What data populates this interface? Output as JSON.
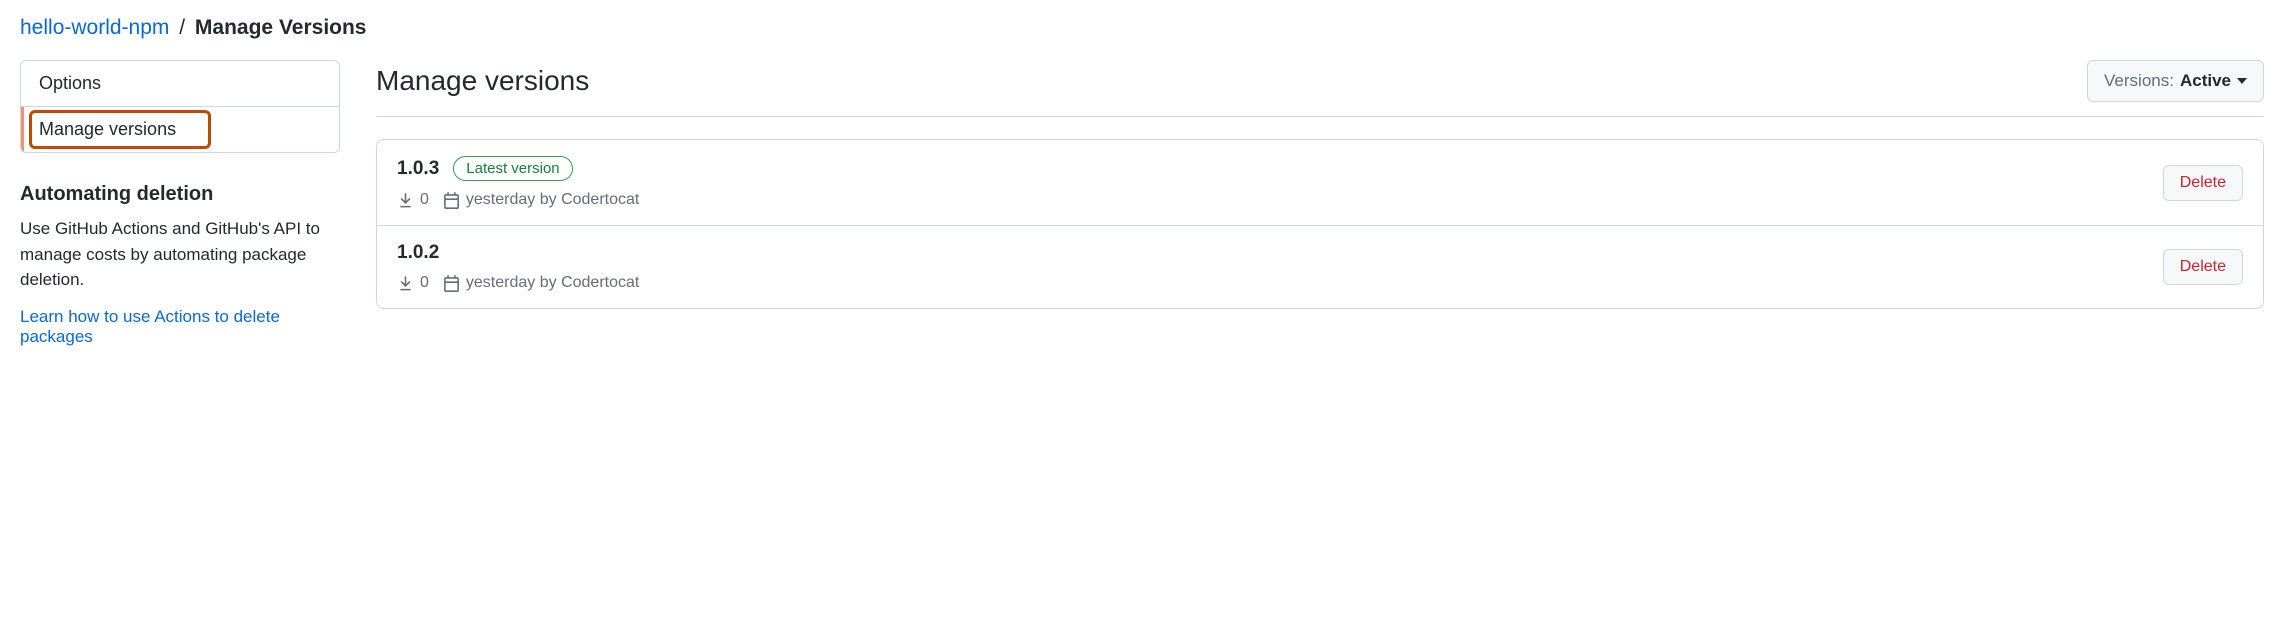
{
  "breadcrumb": {
    "package_name": "hello-world-npm",
    "separator": "/",
    "current": "Manage Versions"
  },
  "sidebar": {
    "menu": [
      {
        "label": "Options"
      },
      {
        "label": "Manage versions"
      }
    ],
    "automating": {
      "heading": "Automating deletion",
      "body": "Use GitHub Actions and GitHub's API to manage costs by automating package deletion.",
      "link_text": "Learn how to use Actions to delete packages"
    }
  },
  "main": {
    "heading": "Manage versions",
    "filter": {
      "label": "Versions:",
      "value": "Active"
    },
    "versions": [
      {
        "name": "1.0.3",
        "latest_badge": "Latest version",
        "is_latest": true,
        "downloads": "0",
        "published": "yesterday by Codertocat",
        "delete_label": "Delete"
      },
      {
        "name": "1.0.2",
        "latest_badge": "",
        "is_latest": false,
        "downloads": "0",
        "published": "yesterday by Codertocat",
        "delete_label": "Delete"
      }
    ]
  }
}
